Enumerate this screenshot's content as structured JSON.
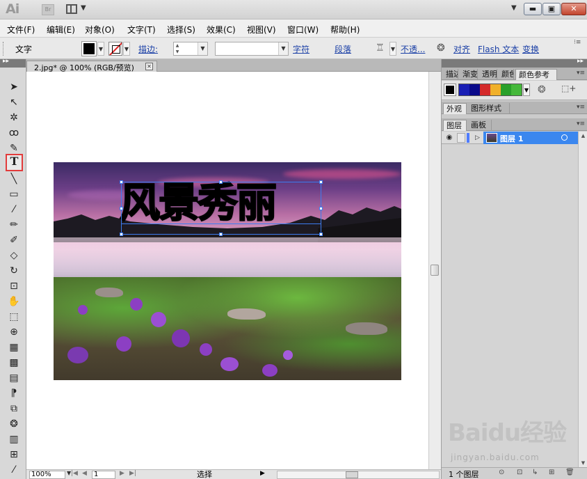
{
  "app": {
    "logo": "Ai",
    "bridge_label": "Br"
  },
  "menu": [
    "文件(F)",
    "编辑(E)",
    "对象(O)",
    "文字(T)",
    "选择(S)",
    "效果(C)",
    "视图(V)",
    "窗口(W)",
    "帮助(H)"
  ],
  "control_bar": {
    "tool_label": "文字",
    "stroke_label": "描边:",
    "stroke_value": "",
    "style_value": "",
    "character_link": "字符",
    "paragraph_link": "段落",
    "opacity_link": "不透...",
    "align_link": "对齐",
    "flash_link": "Flash 文本",
    "transform_link": "变换",
    "fill_color": "#000000"
  },
  "tools": [
    {
      "name": "selection-tool",
      "glyph": "➤"
    },
    {
      "name": "direct-selection-tool",
      "glyph": "↖"
    },
    {
      "name": "magic-wand-tool",
      "glyph": "✲"
    },
    {
      "name": "lasso-tool",
      "glyph": "ꝏ"
    },
    {
      "name": "pen-tool",
      "glyph": "✎"
    },
    {
      "name": "type-tool",
      "glyph": "T"
    },
    {
      "name": "line-segment-tool",
      "glyph": "╲"
    },
    {
      "name": "rectangle-tool",
      "glyph": "▭"
    },
    {
      "name": "paintbrush-tool",
      "glyph": "⁄"
    },
    {
      "name": "pencil-tool",
      "glyph": "✏"
    },
    {
      "name": "blob-brush-tool",
      "glyph": "✐"
    },
    {
      "name": "eraser-tool",
      "glyph": "◇"
    },
    {
      "name": "rotate-tool",
      "glyph": "↻"
    },
    {
      "name": "scale-tool",
      "glyph": "⊡"
    },
    {
      "name": "warp-tool",
      "glyph": "✋"
    },
    {
      "name": "free-transform-tool",
      "glyph": "⬚"
    },
    {
      "name": "shape-builder-tool",
      "glyph": "⊕"
    },
    {
      "name": "perspective-grid-tool",
      "glyph": "▦"
    },
    {
      "name": "mesh-tool",
      "glyph": "▩"
    },
    {
      "name": "gradient-tool",
      "glyph": "▤"
    },
    {
      "name": "eyedropper-tool",
      "glyph": "⁋"
    },
    {
      "name": "blend-tool",
      "glyph": "⧉"
    },
    {
      "name": "symbol-sprayer-tool",
      "glyph": "❂"
    },
    {
      "name": "column-graph-tool",
      "glyph": "▥"
    },
    {
      "name": "artboard-tool",
      "glyph": "⊞"
    },
    {
      "name": "slice-tool",
      "glyph": "⁄"
    }
  ],
  "document": {
    "tab_label": "2.jpg* @ 100% (RGB/预览)",
    "artwork_text": "风景秀丽"
  },
  "status": {
    "zoom": "100%",
    "page": "1",
    "mode": "选择"
  },
  "panels": {
    "top_tabs": [
      "描边",
      "渐变",
      "透明",
      "颜色",
      "颜色参考"
    ],
    "guide_colors": [
      "#1a1fb5",
      "#0a0a8a",
      "#d42a2a",
      "#f0b02a",
      "#2aa02a",
      "#45b83a"
    ],
    "mid_tabs": [
      "外观",
      "图形样式"
    ],
    "layer_tabs": [
      "图层",
      "画板"
    ],
    "layer_name": "图层 1",
    "layer_count": "1 个图层"
  },
  "watermark": {
    "logo": "Baidu经验",
    "url": "jingyan.baidu.com"
  }
}
